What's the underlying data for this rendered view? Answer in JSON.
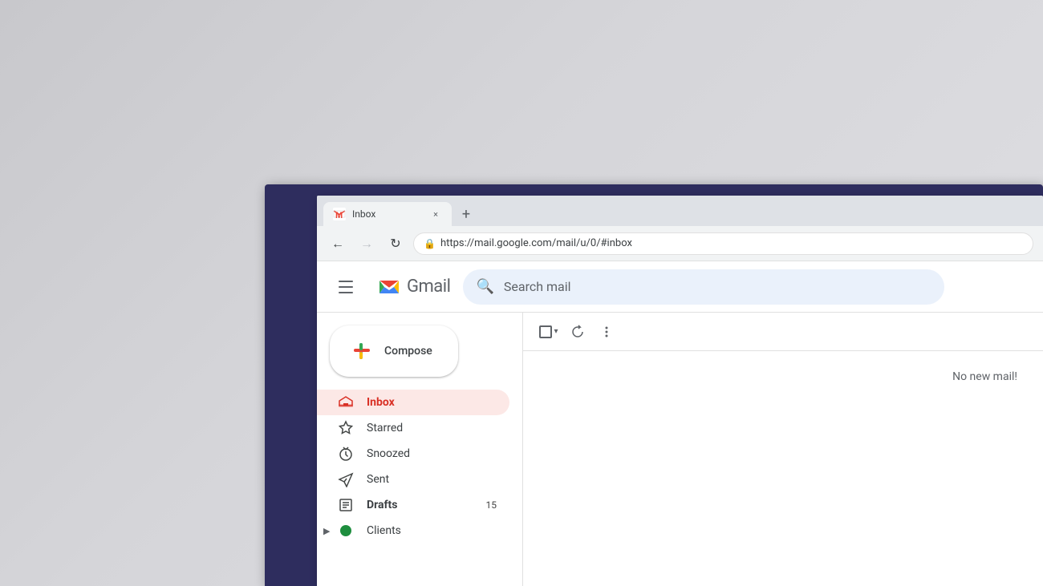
{
  "monitor": {
    "bezel_color": "#2e2d5e"
  },
  "browser": {
    "tab": {
      "favicon": "M",
      "title": "Inbox",
      "close_label": "×"
    },
    "new_tab_label": "+",
    "nav": {
      "back_label": "←",
      "forward_label": "→",
      "reload_label": "↻"
    },
    "url": "https://mail.google.com/mail/u/0/#inbox"
  },
  "gmail": {
    "app_name": "Gmail",
    "header": {
      "search_placeholder": "Search mail"
    },
    "compose": {
      "label": "Compose"
    },
    "sidebar": {
      "items": [
        {
          "id": "inbox",
          "label": "Inbox",
          "active": true,
          "badge": "",
          "icon": "inbox"
        },
        {
          "id": "starred",
          "label": "Starred",
          "active": false,
          "badge": "",
          "icon": "star"
        },
        {
          "id": "snoozed",
          "label": "Snoozed",
          "active": false,
          "badge": "",
          "icon": "clock"
        },
        {
          "id": "sent",
          "label": "Sent",
          "active": false,
          "badge": "",
          "icon": "send"
        },
        {
          "id": "drafts",
          "label": "Drafts",
          "active": false,
          "badge": "15",
          "icon": "draft"
        },
        {
          "id": "clients",
          "label": "Clients",
          "active": false,
          "badge": "",
          "icon": "clients"
        }
      ]
    },
    "toolbar": {
      "select_all_title": "Select",
      "refresh_title": "Refresh",
      "more_title": "More"
    },
    "empty_state": {
      "message": "No new mail!"
    }
  }
}
